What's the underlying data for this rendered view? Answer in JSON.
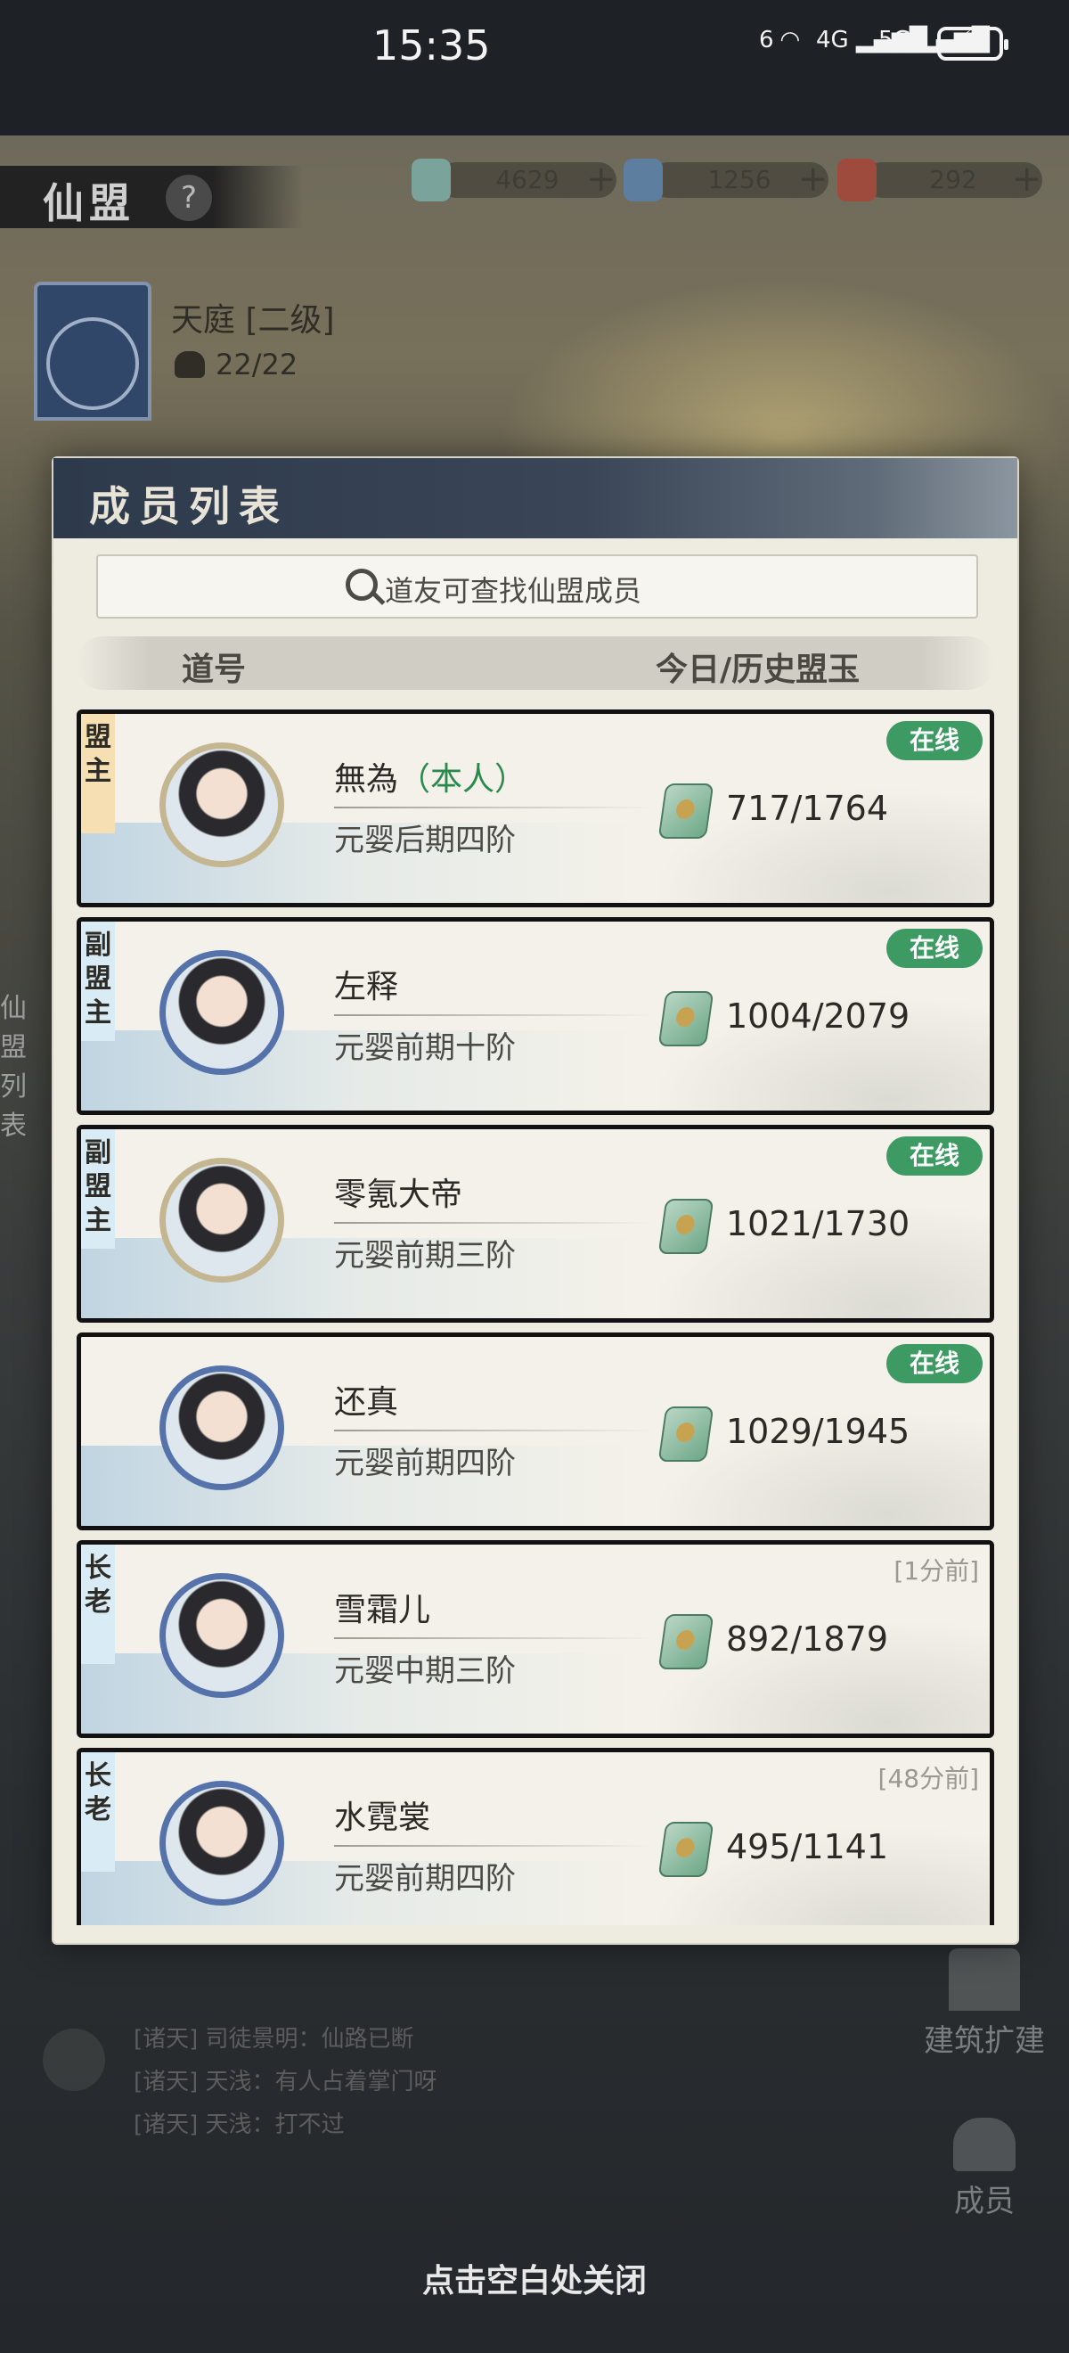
{
  "status_bar": {
    "time": "15:35",
    "wifi_label": "6",
    "net1": "4G",
    "net2": "5G"
  },
  "game": {
    "panel_title": "仙盟",
    "help_glyph": "?",
    "resources": [
      {
        "icon": "jade-token-icon",
        "value": "4629"
      },
      {
        "icon": "spirit-stone-icon",
        "value": "1256"
      },
      {
        "icon": "scroll-icon",
        "value": "292"
      }
    ],
    "sect_name": "天庭 [二级]",
    "member_count": "22/22",
    "side_tab": "仙盟列表",
    "build_label": "建筑扩建",
    "members_label": "成员",
    "chat": [
      "[诸天] 司徒景明：仙路已断",
      "[诸天] 天浅：有人占着掌门呀",
      "[诸天] 天浅：打不过"
    ]
  },
  "modal": {
    "title": "成员列表",
    "search_placeholder": "道友可查找仙盟成员",
    "col_name": "道号",
    "col_jade": "今日/历史盟玉",
    "members": [
      {
        "role": "盟主",
        "role_color": "#f6dfb3",
        "name": "無為",
        "self_tag": "（本人）",
        "rank": "元婴后期四阶",
        "jade": "717/1764",
        "status": "在线",
        "online": true,
        "frame": "gold"
      },
      {
        "role": "副盟主",
        "role_color": "#d9ecf5",
        "name": "左释",
        "self_tag": "",
        "rank": "元婴前期十阶",
        "jade": "1004/2079",
        "status": "在线",
        "online": true,
        "frame": "blue"
      },
      {
        "role": "副盟主",
        "role_color": "#d9ecf5",
        "name": "零氪大帝",
        "self_tag": "",
        "rank": "元婴前期三阶",
        "jade": "1021/1730",
        "status": "在线",
        "online": true,
        "frame": "gold"
      },
      {
        "role": "",
        "role_color": "",
        "name": "还真",
        "self_tag": "",
        "rank": "元婴前期四阶",
        "jade": "1029/1945",
        "status": "在线",
        "online": true,
        "frame": "blue"
      },
      {
        "role": "长老",
        "role_color": "#d9ecf5",
        "name": "雪霜儿",
        "self_tag": "",
        "rank": "元婴中期三阶",
        "jade": "892/1879",
        "status": "[1分前]",
        "online": false,
        "frame": "blue"
      },
      {
        "role": "长老",
        "role_color": "#d9ecf5",
        "name": "水霓裳",
        "self_tag": "",
        "rank": "元婴前期四阶",
        "jade": "495/1141",
        "status": "[48分前]",
        "online": false,
        "frame": "blue"
      }
    ]
  },
  "close_hint": "点击空白处关闭"
}
